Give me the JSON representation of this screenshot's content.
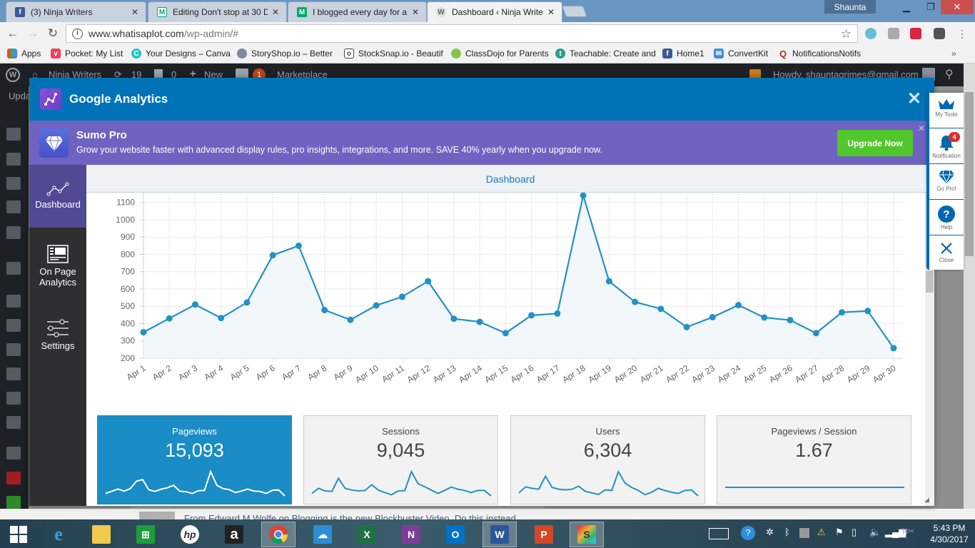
{
  "browser": {
    "tabs": [
      {
        "title": "(3) Ninja Writers",
        "icon": "facebook-icon",
        "active": false
      },
      {
        "title": "Editing Don't stop at 30 D",
        "icon": "medium-icon",
        "active": false
      },
      {
        "title": "I blogged every day for a",
        "icon": "medium-icon",
        "active": false
      },
      {
        "title": "Dashboard ‹ Ninja Writer",
        "icon": "wordpress-icon",
        "active": true
      }
    ],
    "profile_name": "Shaunta",
    "url_host": "www.whatisaplot.com",
    "url_path": "/wp-admin/#",
    "bookmarks": [
      {
        "label": "Apps",
        "icon": "apps-grid-icon",
        "color": "#e44"
      },
      {
        "label": "Pocket: My List",
        "icon": "pocket-icon",
        "color": "#ef4056"
      },
      {
        "label": "Your Designs – Canva",
        "icon": "canva-icon",
        "color": "#20c4cb"
      },
      {
        "label": "StoryShop.io – Better",
        "icon": "storyshop-icon",
        "color": "#7a8a99"
      },
      {
        "label": "StockSnap.io - Beautif",
        "icon": "camera-icon",
        "color": "#444"
      },
      {
        "label": "ClassDojo for Parents",
        "icon": "classdojo-icon",
        "color": "#8bc34a"
      },
      {
        "label": "Teachable: Create and",
        "icon": "teachable-icon",
        "color": "#2a9d8f"
      },
      {
        "label": "Home1",
        "icon": "facebook-icon",
        "color": "#3b5998"
      },
      {
        "label": "ConvertKit",
        "icon": "mail-icon",
        "color": "#3b8fd9"
      },
      {
        "label": "NotificationsNotifs",
        "icon": "quora-icon",
        "color": "#b92b27"
      }
    ]
  },
  "wp": {
    "site_name": "Ninja Writers",
    "updates_count": "19",
    "comments_count": "0",
    "new_label": "New",
    "yoast_badge": "1",
    "marketplace_label": "Marketplace",
    "howdy": "Howdy, shauntagrimes@gmail.com",
    "update_prefix": "Upda",
    "background_text": "From Edward M Wolfe on Blogging is the new Blockbuster Video. Do this instead."
  },
  "modal": {
    "title": "Google Analytics",
    "promo": {
      "title": "Sumo Pro",
      "text": "Grow your website faster with advanced display rules, pro insights, integrations, and more. SAVE 40% yearly when you upgrade now.",
      "button": "Upgrade Now"
    },
    "nav": [
      {
        "label": "Dashboard",
        "icon": "line-chart-icon",
        "active": true
      },
      {
        "label": "On Page Analytics",
        "icon": "page-analytics-icon",
        "active": false
      },
      {
        "label": "Settings",
        "icon": "sliders-icon",
        "active": false
      }
    ],
    "section_title": "Dashboard",
    "cards": [
      {
        "label": "Pageviews",
        "value": "15,093",
        "active": true
      },
      {
        "label": "Sessions",
        "value": "9,045",
        "active": false
      },
      {
        "label": "Users",
        "value": "6,304",
        "active": false
      },
      {
        "label": "Pageviews / Session",
        "value": "1.67",
        "active": false
      }
    ]
  },
  "sumo_sidebar": [
    {
      "label": "My Tools",
      "icon": "crown-icon"
    },
    {
      "label": "Notification",
      "icon": "bell-icon",
      "badge": "4"
    },
    {
      "label": "Go Pro!",
      "icon": "diamond-icon"
    },
    {
      "label": "Help",
      "icon": "help-icon"
    },
    {
      "label": "Close",
      "icon": "close-icon"
    }
  ],
  "taskbar": {
    "apps": [
      "start",
      "internet-explorer",
      "file-explorer",
      "store",
      "hp",
      "amazon",
      "chrome",
      "onedrive",
      "excel",
      "onenote",
      "outlook",
      "word",
      "powerpoint",
      "slack"
    ],
    "active_apps": [
      "chrome",
      "word",
      "slack"
    ],
    "time": "5:43 PM",
    "date": "4/30/2017"
  },
  "chart_data": {
    "type": "line",
    "title": "",
    "xlabel": "",
    "ylabel": "",
    "categories": [
      "Apr 1",
      "Apr 2",
      "Apr 3",
      "Apr 4",
      "Apr 5",
      "Apr 6",
      "Apr 7",
      "Apr 8",
      "Apr 9",
      "Apr 10",
      "Apr 11",
      "Apr 12",
      "Apr 13",
      "Apr 14",
      "Apr 15",
      "Apr 16",
      "Apr 17",
      "Apr 18",
      "Apr 19",
      "Apr 20",
      "Apr 21",
      "Apr 22",
      "Apr 23",
      "Apr 24",
      "Apr 25",
      "Apr 26",
      "Apr 27",
      "Apr 28",
      "Apr 29",
      "Apr 30"
    ],
    "series": [
      {
        "name": "Pageviews",
        "color": "#2391c8",
        "values": [
          350,
          430,
          510,
          432,
          522,
          795,
          850,
          478,
          422,
          505,
          555,
          645,
          428,
          410,
          345,
          448,
          458,
          1140,
          645,
          525,
          485,
          380,
          437,
          507,
          435,
          420,
          345,
          465,
          473,
          258
        ]
      }
    ],
    "sparklines": {
      "sessions": [
        210,
        240,
        225,
        222,
        300,
        240,
        230,
        225,
        228,
        262,
        230,
        215,
        202,
        225,
        226,
        340,
        268,
        250,
        230,
        210,
        228,
        248,
        235,
        228,
        215,
        228,
        228,
        195
      ],
      "users": [
        150,
        170,
        165,
        162,
        205,
        168,
        162,
        160,
        162,
        172,
        155,
        150,
        145,
        160,
        158,
        220,
        182,
        168,
        158,
        144,
        152,
        165,
        158,
        152,
        148,
        158,
        160,
        140
      ],
      "pageviews_per_session": [
        1.67,
        1.67,
        1.67,
        1.67,
        1.67,
        1.67,
        1.67,
        1.67,
        1.67,
        1.67,
        1.67,
        1.67,
        1.67,
        1.67,
        1.67,
        1.67,
        1.67,
        1.67,
        1.67,
        1.67,
        1.67,
        1.67,
        1.67,
        1.67,
        1.67,
        1.67,
        1.67,
        1.67,
        1.67,
        1.67
      ]
    },
    "yticks": [
      200,
      300,
      400,
      500,
      600,
      700,
      800,
      900,
      1000,
      1100
    ],
    "ylim": [
      200,
      1140
    ],
    "grid": true,
    "legend": "none"
  }
}
